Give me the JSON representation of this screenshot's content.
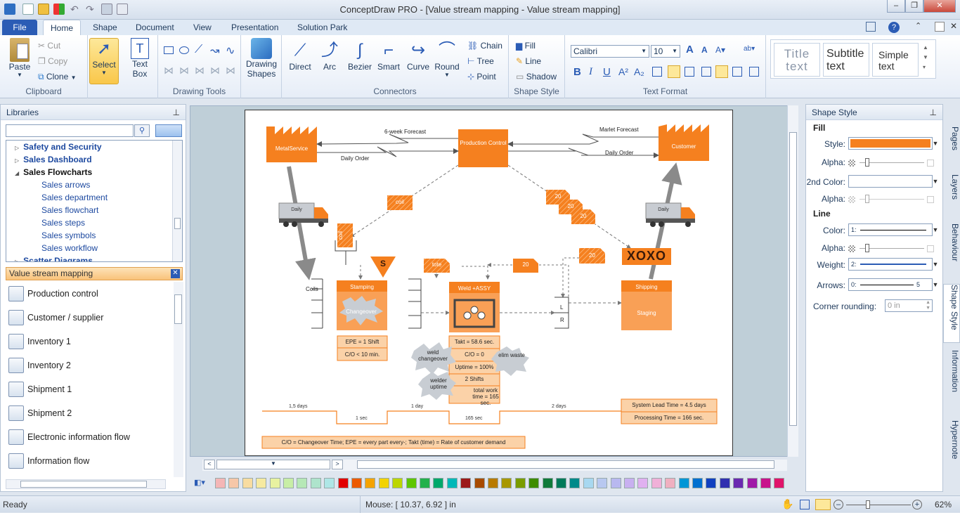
{
  "window": {
    "title": "ConceptDraw PRO - [Value stream mapping - Value stream mapping]"
  },
  "tabs": [
    "File",
    "Home",
    "Shape",
    "Document",
    "View",
    "Presentation",
    "Solution Park"
  ],
  "active_tab": "Home",
  "ribbon": {
    "clipboard": {
      "paste": "Paste",
      "cut": "Cut",
      "copy": "Copy",
      "clone": "Clone",
      "label": "Clipboard"
    },
    "select": {
      "select": "Select",
      "textbox": "Text Box",
      "label": ""
    },
    "drawing_tools": {
      "label": "Drawing Tools",
      "drawing_shapes": "Drawing Shapes"
    },
    "connectors": {
      "label": "Connectors",
      "items": [
        "Direct",
        "Arc",
        "Bezier",
        "Smart",
        "Curve",
        "Round"
      ],
      "chain": "Chain",
      "tree": "Tree",
      "point": "Point"
    },
    "shape_style": {
      "label": "Shape Style",
      "fill": "Fill",
      "line": "Line",
      "shadow": "Shadow"
    },
    "text_format": {
      "label": "Text Format",
      "font": "Calibri",
      "size": "10"
    },
    "text_styles": {
      "title": "Title text",
      "subtitle": "Subtitle text",
      "simple": "Simple text"
    }
  },
  "libraries": {
    "header": "Libraries",
    "tree": [
      {
        "label": "Safety and Security",
        "level": 0,
        "bold": true
      },
      {
        "label": "Sales Dashboard",
        "level": 0,
        "bold": true
      },
      {
        "label": "Sales Flowcharts",
        "level": 0,
        "bold": true,
        "open": true
      },
      {
        "label": "Sales arrows",
        "level": 1
      },
      {
        "label": "Sales department",
        "level": 1
      },
      {
        "label": "Sales flowchart",
        "level": 1
      },
      {
        "label": "Sales steps",
        "level": 1
      },
      {
        "label": "Sales symbols",
        "level": 1
      },
      {
        "label": "Sales workflow",
        "level": 1
      },
      {
        "label": "Scatter Diagrams",
        "level": 0,
        "bold": true
      }
    ],
    "active_library": "Value stream mapping",
    "items": [
      "Production control",
      "Customer / supplier",
      "Inventory 1",
      "Inventory 2",
      "Shipment 1",
      "Shipment 2",
      "Electronic information flow",
      "Information flow"
    ]
  },
  "diagram": {
    "metalservice": "MetalService",
    "production_control": "Production Control",
    "customer": "Customer",
    "forecast6": "6-week Forecast",
    "daily_order_left": "Daily Order",
    "market_forecast": "Marlet Forecast",
    "daily_order_right": "Daily Order",
    "coil": "coil",
    "coil_vert": "coil",
    "num20a": "20",
    "num20b": "20",
    "num20c": "20",
    "num20d": "20",
    "num20e": "20",
    "daily_left": "Daily",
    "daily_right": "Daily",
    "xoxo": "XOXO",
    "s": "S",
    "tote": "tote",
    "coils": "Coils",
    "stamping": "Stamping",
    "changeover": "Changeover",
    "weld_assy": "Weld +ASSY",
    "shipping": "Shipping",
    "staging": "Staging",
    "l": "L",
    "r": "R",
    "epe": "EPE = 1 Shift",
    "co_stamp": "C/O < 10 min.",
    "takt": "Takt = 58.6 sec.",
    "co_weld": "C/O = 0",
    "uptime": "Uptime = 100%",
    "shifts": "2 Shifts",
    "total_work": "total work time = 165 sec.",
    "weld_changeover": "weld changeover",
    "elim_waste": "elim waste",
    "welder_uptime": "welder uptime",
    "days15": "1,5 days",
    "day1": "1 day",
    "days2": "2 days",
    "sec1": "1 sec",
    "sec165": "165 sec",
    "system_lead": "System Lead Time = 4.5 days",
    "processing": "Processing Time = 166 sec.",
    "legend": "C/O = Changeover Time; EPE = every part every-; Takt (time) = Rate of customer demand"
  },
  "shape_style_panel": {
    "header": "Shape Style",
    "fill": "Fill",
    "style": "Style:",
    "alpha": "Alpha:",
    "second_color": "2nd Color:",
    "alpha2": "Alpha:",
    "line": "Line",
    "color": "Color:",
    "line_color_value": "1:",
    "alpha3": "Alpha:",
    "weight": "Weight:",
    "weight_value": "2:",
    "arrows": "Arrows:",
    "arrows_from": "0:",
    "arrows_to": "5",
    "corner": "Corner rounding:",
    "corner_value": "0 in",
    "fill_color": "#f5801f"
  },
  "side_tabs": [
    "Pages",
    "Layers",
    "Behaviour",
    "Shape Style",
    "Information",
    "Hypernote"
  ],
  "status": {
    "ready": "Ready",
    "mouse": "Mouse: [ 10.37, 6.92 ] in",
    "zoom": "62%"
  },
  "palette": [
    "#f4b6b6",
    "#f6c7a8",
    "#f8dca0",
    "#f6eaa0",
    "#e8f2a0",
    "#c8eea6",
    "#b6e8b6",
    "#aee4cc",
    "#aee6e6",
    "#e20000",
    "#ec5a00",
    "#f5a300",
    "#f2d300",
    "#bcd600",
    "#5ec600",
    "#22b14c",
    "#00a86b",
    "#00b8b8",
    "#9c1a1a",
    "#a84b00",
    "#b87a00",
    "#a89800",
    "#7a9c00",
    "#3e8c00",
    "#107a3a",
    "#007a5a",
    "#008a8a",
    "#a8d8f0",
    "#b8c8f0",
    "#b8b8f0",
    "#c8b0f0",
    "#e0b0f0",
    "#f0b0d8",
    "#f0b0c0",
    "#0096d6",
    "#0070d0",
    "#1040c0",
    "#3030b0",
    "#6a2ab0",
    "#a01aa8",
    "#c8148c",
    "#e0146a"
  ]
}
